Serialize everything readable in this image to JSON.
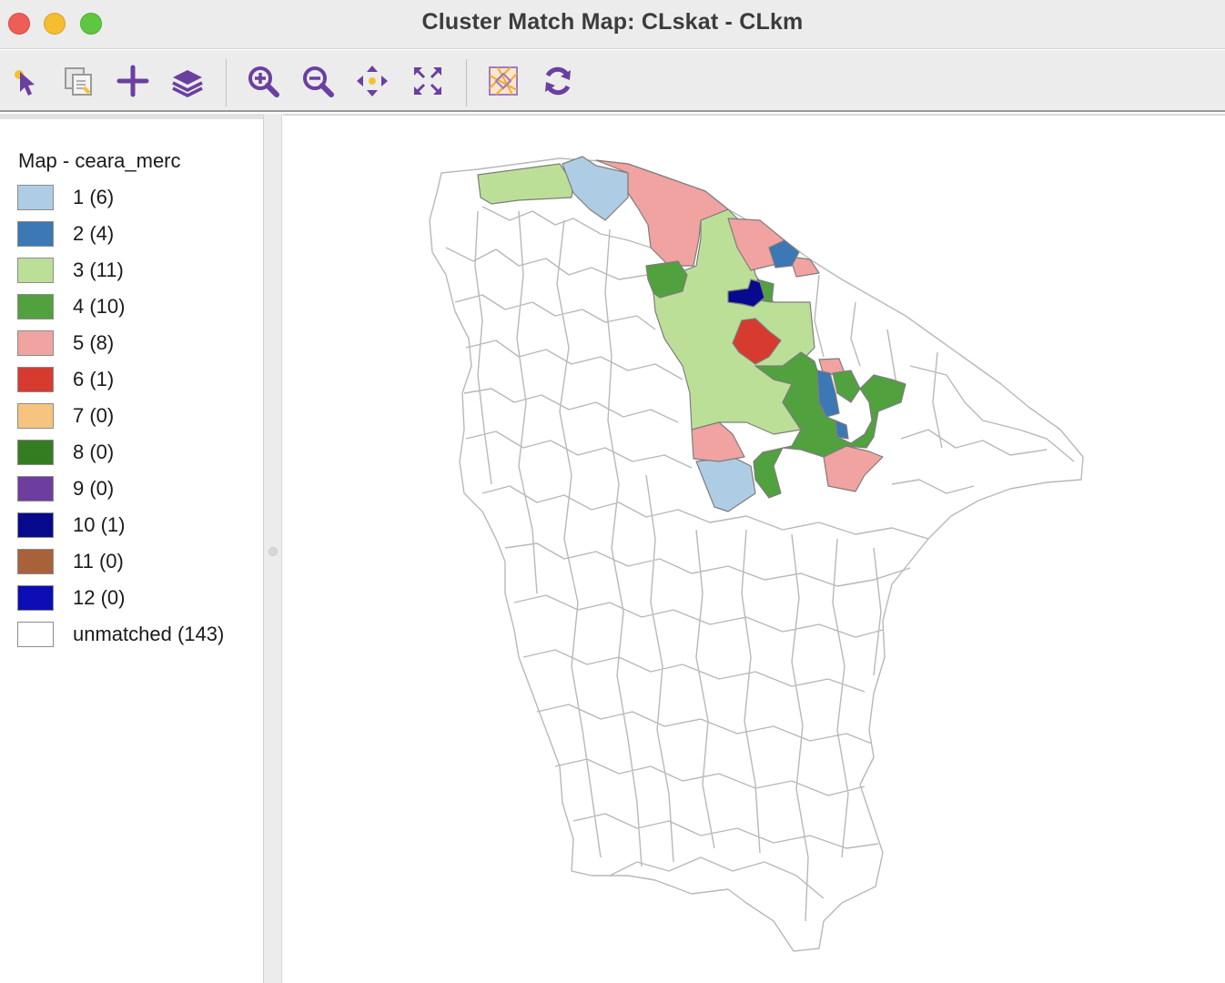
{
  "window": {
    "title": "Cluster Match Map: CLskat - CLkm",
    "controls": [
      "close",
      "minimize",
      "zoom"
    ]
  },
  "toolbar": {
    "buttons": [
      {
        "icon": "select-pointer-icon",
        "label": "Select"
      },
      {
        "icon": "copy-selection-icon",
        "label": "Copy"
      },
      {
        "icon": "add-icon",
        "label": "Add"
      },
      {
        "icon": "layers-icon",
        "label": "Layers"
      },
      {
        "icon": "zoom-in-icon",
        "label": "Zoom In"
      },
      {
        "icon": "zoom-out-icon",
        "label": "Zoom Out"
      },
      {
        "icon": "pan-icon",
        "label": "Pan"
      },
      {
        "icon": "full-extent-icon",
        "label": "Full Extent"
      },
      {
        "icon": "basemap-icon",
        "label": "Basemap"
      },
      {
        "icon": "refresh-icon",
        "label": "Refresh"
      }
    ],
    "accent_color": "#6b3fa0"
  },
  "legend": {
    "title": "Map - ceara_merc",
    "items": [
      {
        "label": "1 (6)",
        "color": "#aecde4"
      },
      {
        "label": "2 (4)",
        "color": "#3b78b4"
      },
      {
        "label": "3 (11)",
        "color": "#bcdf98"
      },
      {
        "label": "4 (10)",
        "color": "#52a13f"
      },
      {
        "label": "5 (8)",
        "color": "#f0a3a1"
      },
      {
        "label": "6 (1)",
        "color": "#d73a2f"
      },
      {
        "label": "7 (0)",
        "color": "#f6c47e"
      },
      {
        "label": "8 (0)",
        "color": "#347d22"
      },
      {
        "label": "9 (0)",
        "color": "#6d3e9e"
      },
      {
        "label": "10 (1)",
        "color": "#070a8c"
      },
      {
        "label": "11 (0)",
        "color": "#a9613a"
      },
      {
        "label": "12 (0)",
        "color": "#0c0db4"
      },
      {
        "label": "unmatched (143)",
        "color": "#ffffff"
      }
    ]
  },
  "map": {
    "layer": "ceara_merc",
    "boundary_color": "#b8b8b8",
    "cluster_colors": {
      "c1": "#aecde4",
      "c2": "#3b78b4",
      "c3": "#bcdf98",
      "c4": "#52a13f",
      "c5": "#f0a3a1",
      "c6": "#d73a2f",
      "c10": "#070a8c"
    }
  }
}
